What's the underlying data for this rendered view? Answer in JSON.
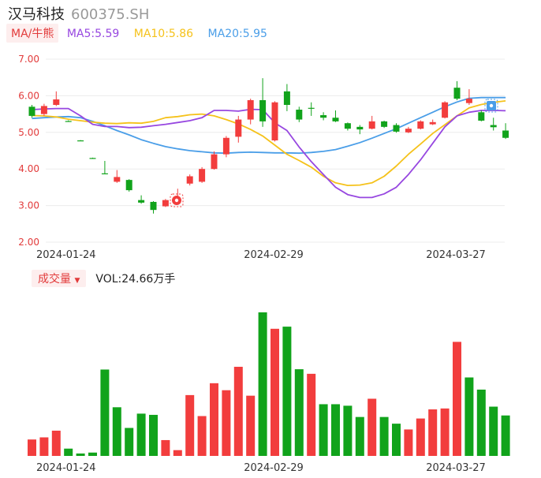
{
  "header": {
    "stock_name": "汉马科技",
    "stock_code": "600375.SH"
  },
  "legend": {
    "ma_toggle": "MA/牛熊",
    "ma5": "MA5:5.59",
    "ma10": "MA10:5.86",
    "ma20": "MA20:5.95"
  },
  "volume_legend": {
    "toggle": "成交量",
    "value": "VOL:24.66万手"
  },
  "colors": {
    "up": "#f23d3d",
    "down": "#11a31b",
    "ma5": "#9747e0",
    "ma10": "#f5c21b",
    "ma20": "#4a9ee8",
    "axis_label": "#e23b3b"
  },
  "chart_data": [
    {
      "type": "candlestick",
      "y_ticks": [
        "7.00",
        "6.00",
        "5.00",
        "4.00",
        "3.00",
        "2.00"
      ],
      "ylim": [
        2.0,
        7.0
      ],
      "x_tick_labels": [
        "2024-01-24",
        "2024-02-29",
        "2024-03-27"
      ],
      "candles": [
        {
          "o": 5.7,
          "c": 5.45,
          "h": 5.75,
          "l": 5.4
        },
        {
          "o": 5.5,
          "c": 5.72,
          "h": 5.78,
          "l": 5.45
        },
        {
          "o": 5.75,
          "c": 5.9,
          "h": 6.12,
          "l": 5.72
        },
        {
          "o": 5.31,
          "c": 5.3,
          "h": 5.33,
          "l": 5.29
        },
        {
          "o": 4.78,
          "c": 4.77,
          "h": 4.79,
          "l": 4.76
        },
        {
          "o": 4.3,
          "c": 4.29,
          "h": 4.31,
          "l": 4.28
        },
        {
          "o": 3.88,
          "c": 3.87,
          "h": 4.22,
          "l": 3.86
        },
        {
          "o": 3.65,
          "c": 3.78,
          "h": 3.97,
          "l": 3.62
        },
        {
          "o": 3.7,
          "c": 3.42,
          "h": 3.72,
          "l": 3.38
        },
        {
          "o": 3.15,
          "c": 3.08,
          "h": 3.28,
          "l": 3.05
        },
        {
          "o": 3.1,
          "c": 2.88,
          "h": 3.12,
          "l": 2.78
        },
        {
          "o": 2.98,
          "c": 3.15,
          "h": 3.18,
          "l": 2.96
        },
        {
          "o": 3.17,
          "c": 3.19,
          "h": 3.46,
          "l": 3.15
        },
        {
          "o": 3.6,
          "c": 3.8,
          "h": 3.85,
          "l": 3.55
        },
        {
          "o": 3.65,
          "c": 4.0,
          "h": 4.05,
          "l": 3.62
        },
        {
          "o": 4.0,
          "c": 4.4,
          "h": 4.48,
          "l": 3.98
        },
        {
          "o": 4.4,
          "c": 4.85,
          "h": 4.9,
          "l": 4.32
        },
        {
          "o": 4.88,
          "c": 5.35,
          "h": 5.45,
          "l": 4.72
        },
        {
          "o": 5.35,
          "c": 5.88,
          "h": 5.92,
          "l": 5.22
        },
        {
          "o": 5.88,
          "c": 5.3,
          "h": 6.48,
          "l": 5.15
        },
        {
          "o": 4.78,
          "c": 5.82,
          "h": 5.85,
          "l": 4.75
        },
        {
          "o": 6.12,
          "c": 5.75,
          "h": 6.32,
          "l": 5.58
        },
        {
          "o": 5.62,
          "c": 5.35,
          "h": 5.7,
          "l": 5.28
        },
        {
          "o": 5.67,
          "c": 5.66,
          "h": 5.82,
          "l": 5.45
        },
        {
          "o": 5.47,
          "c": 5.4,
          "h": 5.55,
          "l": 5.33
        },
        {
          "o": 5.4,
          "c": 5.3,
          "h": 5.6,
          "l": 5.28
        },
        {
          "o": 5.25,
          "c": 5.1,
          "h": 5.27,
          "l": 5.05
        },
        {
          "o": 5.15,
          "c": 5.08,
          "h": 5.2,
          "l": 4.95
        },
        {
          "o": 5.1,
          "c": 5.3,
          "h": 5.45,
          "l": 5.08
        },
        {
          "o": 5.3,
          "c": 5.15,
          "h": 5.32,
          "l": 5.12
        },
        {
          "o": 5.2,
          "c": 5.02,
          "h": 5.25,
          "l": 4.99
        },
        {
          "o": 5.0,
          "c": 5.1,
          "h": 5.15,
          "l": 4.98
        },
        {
          "o": 5.1,
          "c": 5.3,
          "h": 5.33,
          "l": 5.08
        },
        {
          "o": 5.22,
          "c": 5.28,
          "h": 5.35,
          "l": 5.2
        },
        {
          "o": 5.4,
          "c": 5.82,
          "h": 5.85,
          "l": 5.38
        },
        {
          "o": 6.22,
          "c": 5.92,
          "h": 6.4,
          "l": 5.88
        },
        {
          "o": 5.8,
          "c": 5.92,
          "h": 6.18,
          "l": 5.75
        },
        {
          "o": 5.55,
          "c": 5.32,
          "h": 5.6,
          "l": 5.3
        },
        {
          "o": 5.2,
          "c": 5.14,
          "h": 5.4,
          "l": 5.05
        },
        {
          "o": 5.05,
          "c": 4.85,
          "h": 5.25,
          "l": 4.82
        }
      ],
      "ma5": [
        5.62,
        5.64,
        5.65,
        5.65,
        5.45,
        5.22,
        5.16,
        5.16,
        5.13,
        5.14,
        5.18,
        5.22,
        5.27,
        5.32,
        5.4,
        5.6,
        5.6,
        5.58,
        5.63,
        5.62,
        5.26,
        5.05,
        4.6,
        4.2,
        3.85,
        3.5,
        3.3,
        3.22,
        3.22,
        3.32,
        3.5,
        3.85,
        4.25,
        4.7,
        5.15,
        5.45,
        5.55,
        5.6,
        5.6,
        5.59
      ],
      "ma10": [
        5.46,
        5.45,
        5.42,
        5.36,
        5.32,
        5.28,
        5.25,
        5.24,
        5.26,
        5.25,
        5.3,
        5.4,
        5.43,
        5.48,
        5.5,
        5.45,
        5.35,
        5.23,
        5.08,
        4.9,
        4.65,
        4.4,
        4.23,
        4.05,
        3.8,
        3.62,
        3.55,
        3.56,
        3.62,
        3.8,
        4.08,
        4.4,
        4.68,
        4.97,
        5.21,
        5.45,
        5.67,
        5.76,
        5.82,
        5.86
      ],
      "ma20": [
        5.38,
        5.4,
        5.42,
        5.43,
        5.4,
        5.3,
        5.18,
        5.05,
        4.93,
        4.8,
        4.7,
        4.61,
        4.55,
        4.5,
        4.47,
        4.44,
        4.43,
        4.45,
        4.46,
        4.45,
        4.44,
        4.44,
        4.43,
        4.45,
        4.48,
        4.53,
        4.62,
        4.72,
        4.84,
        4.97,
        5.1,
        5.25,
        5.4,
        5.55,
        5.7,
        5.83,
        5.93,
        5.95,
        5.95,
        5.95
      ]
    },
    {
      "type": "bar",
      "name": "成交量",
      "x_tick_labels": [
        "2024-01-24",
        "2024-02-29",
        "2024-03-27"
      ],
      "values": [
        5.4,
        6.1,
        8.3,
        2.4,
        0.8,
        1.1,
        28.4,
        16.0,
        9.2,
        13.9,
        13.5,
        5.2,
        1.9,
        20.0,
        13.1,
        23.9,
        21.6,
        29.3,
        19.8,
        47.2,
        41.8,
        42.5,
        28.5,
        27.0,
        17.0,
        17.0,
        16.5,
        12.8,
        18.8,
        12.8,
        10.6,
        8.7,
        12.3,
        15.3,
        15.6,
        37.5,
        25.8,
        21.8,
        16.2,
        13.3
      ],
      "direction": [
        "up",
        "up",
        "up",
        "down",
        "down",
        "down",
        "down",
        "down",
        "down",
        "down",
        "down",
        "up",
        "up",
        "up",
        "up",
        "up",
        "up",
        "up",
        "up",
        "down",
        "up",
        "down",
        "down",
        "up",
        "down",
        "down",
        "down",
        "down",
        "up",
        "down",
        "down",
        "up",
        "up",
        "up",
        "up",
        "up",
        "down",
        "down",
        "down",
        "down"
      ]
    }
  ]
}
